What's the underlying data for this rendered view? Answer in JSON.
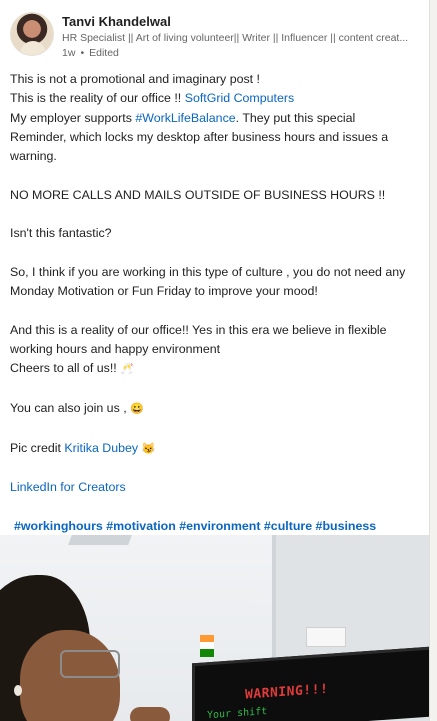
{
  "author": {
    "name": "Tanvi Khandelwal",
    "headline": "HR Specialist || Art of living volunteer|| Writer || Influencer || content creat...",
    "time": "1w",
    "edited": "Edited"
  },
  "post": {
    "line1": "This is not a promotional and imaginary post !",
    "line2_prefix": "This is the reality of our office !! ",
    "line2_link": "SoftGrid Computers",
    "line3_prefix": "My employer supports ",
    "line3_hashtag": "#WorkLifeBalance",
    "line3_suffix": ". They put  this special",
    "line4": "Reminder, which locks my desktop after business hours and issues a",
    "line5": "warning.",
    "line6": "NO MORE CALLS AND MAILS OUTSIDE OF BUSINESS HOURS !!",
    "line7": "Isn't this fantastic?",
    "line8": "So, I think if you are working in this type of culture , you do not need any",
    "line9": "Monday Motivation or Fun Friday to improve your mood!",
    "line10": "And this is a reality of our office!! Yes in this era we  believe  in flexible",
    "line11": "working hours and happy environment",
    "line12": "Cheers to all of us!! ",
    "line12_emoji": "🥂",
    "line13": "You can also join us , ",
    "line13_emoji": "😀",
    "line14_prefix": "Pic credit ",
    "line14_link": "Kritika Dubey",
    "line14_emoji": "😼",
    "line15_link": "LinkedIn for Creators",
    "hashtags": "#workinghours #motivation #environment #culture #business"
  },
  "photo": {
    "monitor_text": "WARNING!!!",
    "monitor_subtext": "Your shift"
  }
}
